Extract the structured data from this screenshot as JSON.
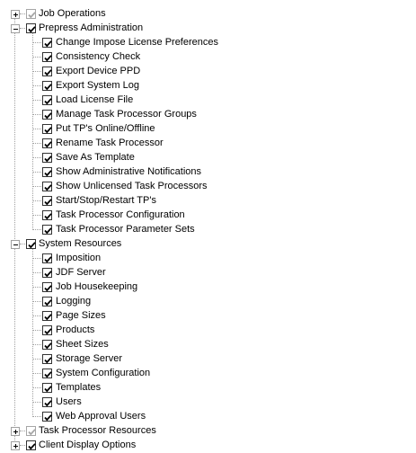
{
  "tree": {
    "nodes": [
      {
        "label": "Job Operations",
        "state": "partial",
        "expanded": false,
        "children": []
      },
      {
        "label": "Prepress Administration",
        "state": "checked",
        "expanded": true,
        "children": [
          "Change Impose License Preferences",
          "Consistency Check",
          "Export Device PPD",
          "Export System Log",
          "Load License File",
          "Manage Task Processor Groups",
          "Put TP's Online/Offline",
          "Rename Task Processor",
          "Save As Template",
          "Show Administrative Notifications",
          "Show Unlicensed Task Processors",
          "Start/Stop/Restart TP's",
          "Task Processor Configuration",
          "Task Processor Parameter Sets"
        ]
      },
      {
        "label": "System Resources",
        "state": "checked",
        "expanded": true,
        "children": [
          "Imposition",
          "JDF Server",
          "Job Housekeeping",
          "Logging",
          "Page Sizes",
          "Products",
          "Sheet Sizes",
          "Storage Server",
          "System Configuration",
          "Templates",
          "Users",
          "Web Approval Users"
        ]
      },
      {
        "label": "Task Processor Resources",
        "state": "partial",
        "expanded": false,
        "children": []
      },
      {
        "label": "Client Display Options",
        "state": "checked",
        "expanded": false,
        "children": []
      }
    ]
  },
  "icons": {
    "expander_collapsed": "plus-box-icon",
    "expander_expanded": "minus-box-icon",
    "checkbox": "check-icon"
  },
  "colors": {
    "checked": "#000000",
    "partial": "#a6a6a6",
    "tree_lines": "#a0a0a0"
  }
}
